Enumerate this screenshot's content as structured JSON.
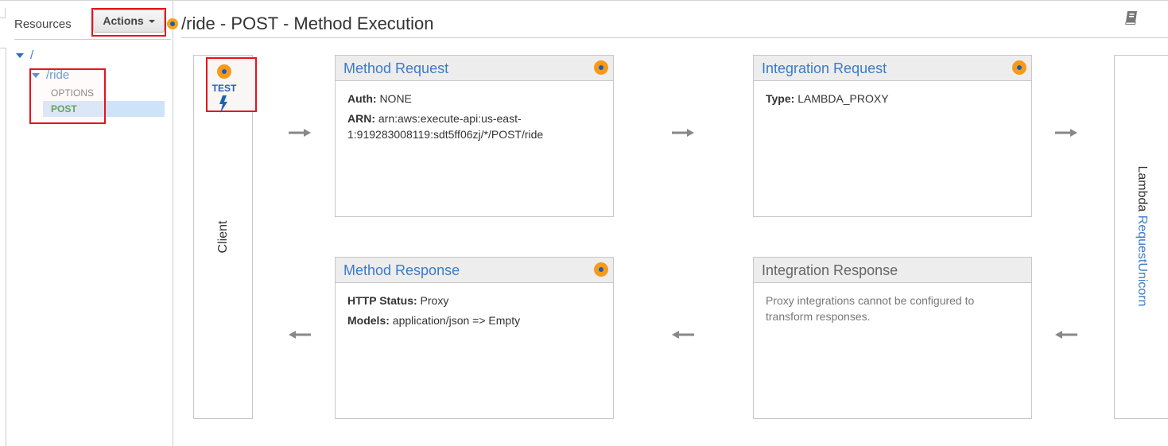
{
  "sidebar": {
    "title": "Resources",
    "actions_label": "Actions",
    "tree": {
      "root": "/",
      "resource": "/ride",
      "methods": [
        "OPTIONS",
        "POST"
      ],
      "selected_method": "POST"
    }
  },
  "header": {
    "title": "/ride - POST - Method Execution",
    "help_icon": "book-icon"
  },
  "client": {
    "test_label": "TEST",
    "label": "Client"
  },
  "method_request": {
    "title": "Method Request",
    "fields": [
      {
        "key": "Auth:",
        "value": "NONE"
      },
      {
        "key": "ARN:",
        "value": "arn:aws:execute-api:us-east-1:919283008119:sdt5ff06zj/*/POST/ride"
      }
    ]
  },
  "integration_request": {
    "title": "Integration Request",
    "fields": [
      {
        "key": "Type:",
        "value": "LAMBDA_PROXY"
      }
    ]
  },
  "method_response": {
    "title": "Method Response",
    "fields": [
      {
        "key": "HTTP Status:",
        "value": "Proxy"
      },
      {
        "key": "Models:",
        "value": "application/json => Empty"
      }
    ]
  },
  "integration_response": {
    "title": "Integration Response",
    "note": "Proxy integrations cannot be configured to transform responses."
  },
  "lambda": {
    "label": "Lambda",
    "function_name": "RequestUnicorn"
  },
  "colors": {
    "link_blue": "#3b7bc8",
    "highlight_red": "#e8121b",
    "status_orange": "#f79a1b",
    "selected_green": "#2e8b2e",
    "selected_bg": "#cfe3f8"
  }
}
